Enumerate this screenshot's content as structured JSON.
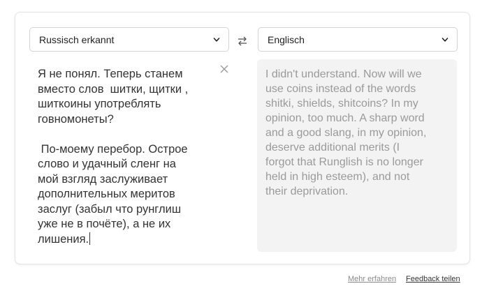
{
  "source_language": {
    "label": "Russisch erkannt"
  },
  "target_language": {
    "label": "Englisch"
  },
  "source_text": "Я не понял. Теперь станем\nвместо слов  шитки, щитки ,\nшиткоины употреблять\nговномонеты?\n\n По-моему перебор. Острое\nслово и удачный сленг на\nмой взгляд заслуживает\nдополнительных меритов\nзаслуг (забыл что рунглиш\nуже не в почёте), а не их\nлишения.",
  "translation_text": "I didn't understand. Now will we\nuse coins instead of the words\nshitki, shields, shitcoins? In my\nopinion, too much. A sharp word\nand a good slang, in my opinion,\ndeserve additional merits (I\nforgot that Runglish is no longer\nheld in high esteem), and not\ntheir deprivation.",
  "footer": {
    "learn_more": "Mehr erfahren",
    "feedback": "Feedback teilen"
  },
  "icons": {
    "swap": "swap-arrows-icon",
    "clear": "close-icon",
    "dropdown": "chevron-down-icon"
  },
  "colors": {
    "source_text": "#333333",
    "translation_text": "#9a9a9a",
    "panel_bg": "#f3f3f3"
  }
}
